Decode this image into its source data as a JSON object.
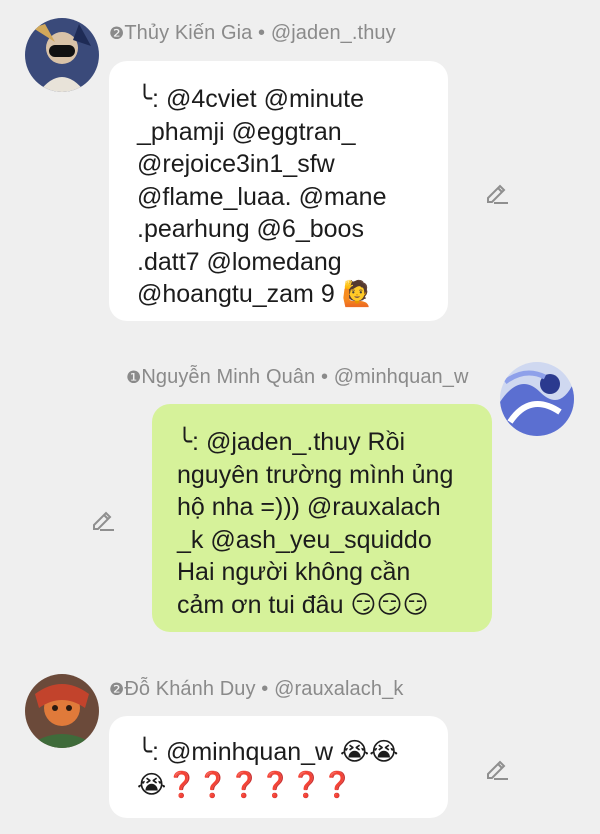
{
  "messages": [
    {
      "rank": "❷",
      "author": "Thủy Kiến Gia",
      "handle": "@jaden_.thuy",
      "lines": [
        "╰: @4cviet @minute",
        "_phamji @eggtran_",
        "@rejoice3in1_sfw",
        "@flame_luaa. @mane",
        ".pearhung @6_boos",
        ".datt7 @lomedang",
        "@hoangtu_zam 9 🙋"
      ]
    },
    {
      "rank": "❶",
      "author": "Nguyễn Minh Quân",
      "handle": "@minhquan_w",
      "lines": [
        "╰: @jaden_.thuy Rồi",
        "nguyên trường mình ủng",
        "hộ nha =))) @rauxalach",
        "_k @ash_yeu_squiddo",
        "Hai người không cần",
        "cảm ơn tui đâu 😏😏😏"
      ]
    },
    {
      "rank": "❷",
      "author": "Đỗ Khánh Duy",
      "handle": "@rauxalach_k",
      "lines": [
        "╰: @minhquan_w 😭😭",
        "😭❓❓❓❓❓❓"
      ]
    }
  ],
  "separator": "•",
  "colors": {
    "background": "#efefef",
    "bubble_white": "#ffffff",
    "bubble_green": "#d6f29a",
    "meta_text": "#8a8a8a"
  },
  "icons": {
    "edit": "pencil-edit-icon"
  }
}
